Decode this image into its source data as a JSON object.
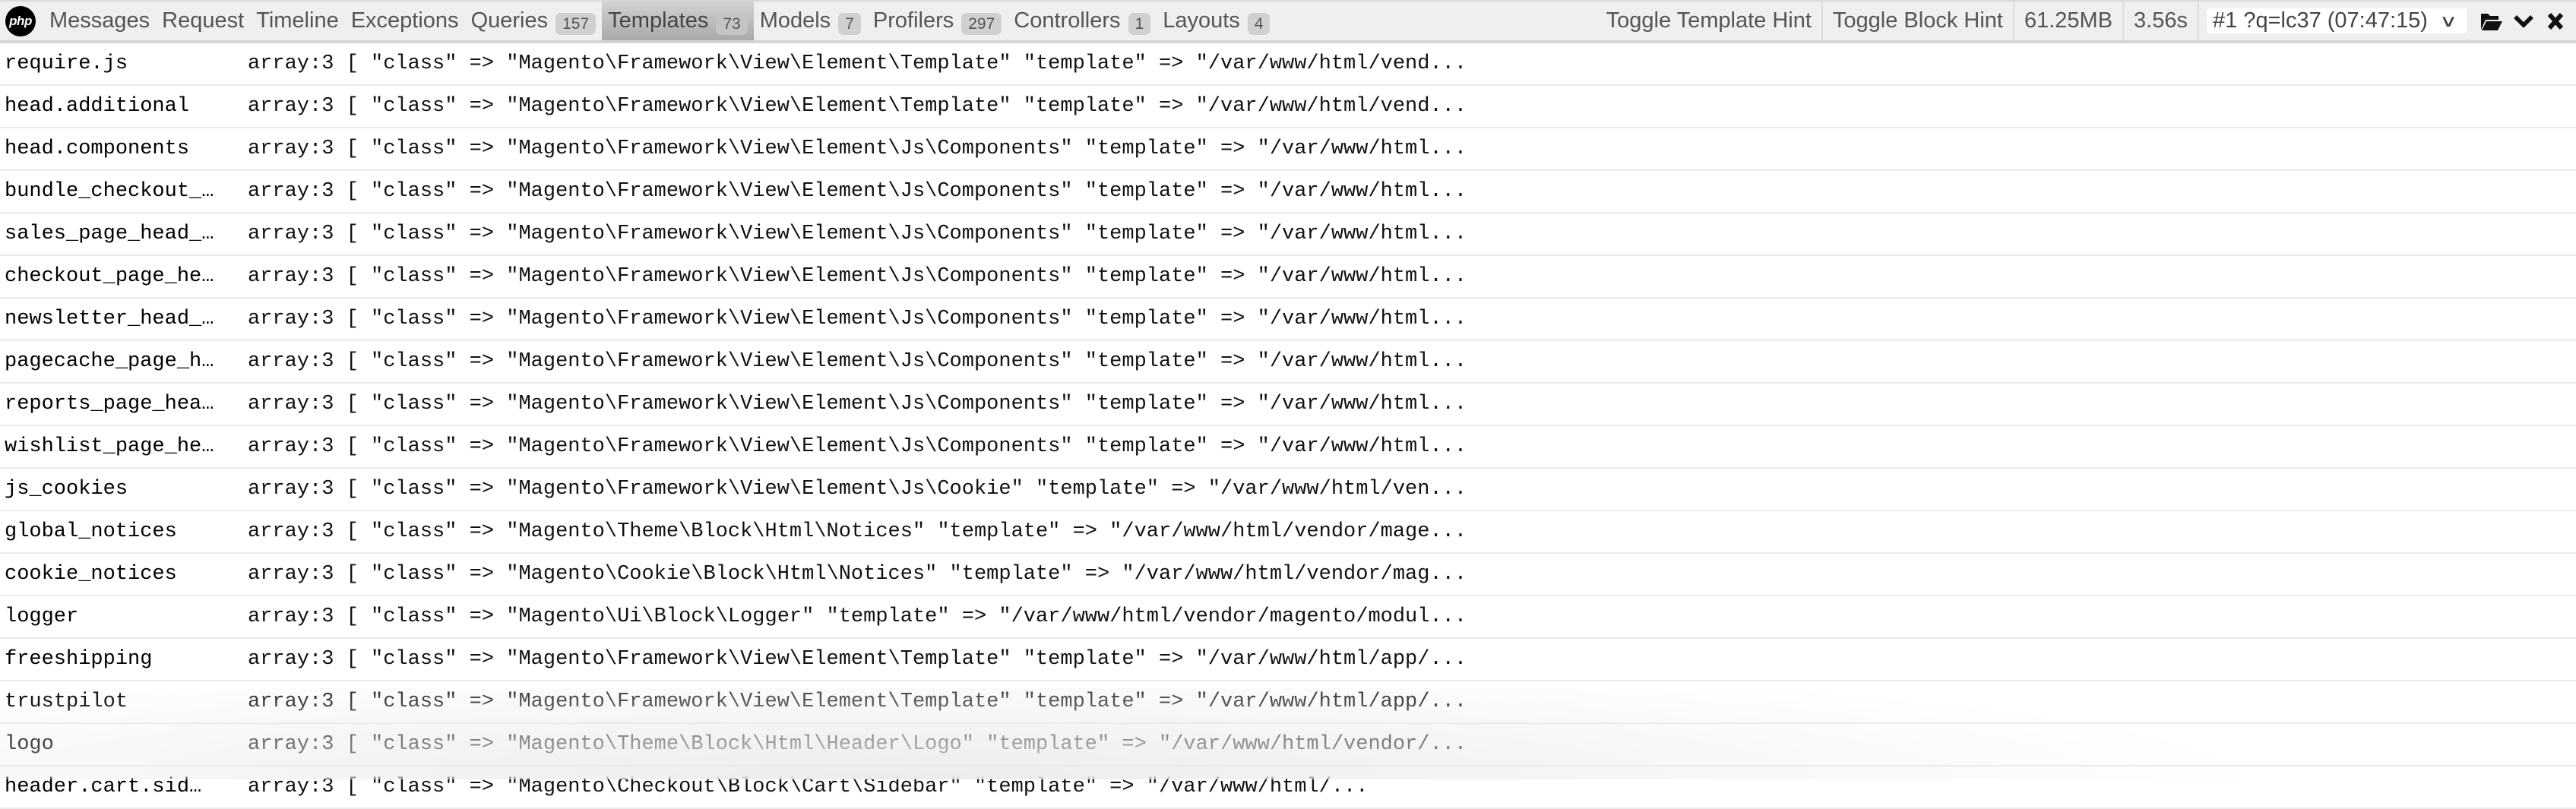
{
  "toolbar": {
    "logo_text": "php",
    "tabs": [
      {
        "label": "Messages",
        "badge": null
      },
      {
        "label": "Request",
        "badge": null
      },
      {
        "label": "Timeline",
        "badge": null
      },
      {
        "label": "Exceptions",
        "badge": null
      },
      {
        "label": "Queries",
        "badge": "157"
      },
      {
        "label": "Templates",
        "badge": "73",
        "active": true
      },
      {
        "label": "Models",
        "badge": "7"
      },
      {
        "label": "Profilers",
        "badge": "297"
      },
      {
        "label": "Controllers",
        "badge": "1"
      },
      {
        "label": "Layouts",
        "badge": "4"
      }
    ],
    "toggle_template_hint": "Toggle Template Hint",
    "toggle_block_hint": "Toggle Block Hint",
    "memory": "61.25MB",
    "duration": "3.56s",
    "request_select": "#1 ?q=lc37 (07:47:15)",
    "icons": {
      "open": "folder-open-icon",
      "minimize": "chevron-down-icon",
      "close": "close-icon"
    }
  },
  "templates": [
    {
      "name": "require.js",
      "value": "array:3 [ \"class\" => \"Magento\\Framework\\View\\Element\\Template\" \"template\" => \"/var/www/html/vend..."
    },
    {
      "name": "head.additional",
      "value": "array:3 [ \"class\" => \"Magento\\Framework\\View\\Element\\Template\" \"template\" => \"/var/www/html/vend..."
    },
    {
      "name": "head.components",
      "value": "array:3 [ \"class\" => \"Magento\\Framework\\View\\Element\\Js\\Components\" \"template\" => \"/var/www/html..."
    },
    {
      "name": "bundle_checkout_…",
      "value": "array:3 [ \"class\" => \"Magento\\Framework\\View\\Element\\Js\\Components\" \"template\" => \"/var/www/html..."
    },
    {
      "name": "sales_page_head_…",
      "value": "array:3 [ \"class\" => \"Magento\\Framework\\View\\Element\\Js\\Components\" \"template\" => \"/var/www/html..."
    },
    {
      "name": "checkout_page_he…",
      "value": "array:3 [ \"class\" => \"Magento\\Framework\\View\\Element\\Js\\Components\" \"template\" => \"/var/www/html..."
    },
    {
      "name": "newsletter_head_…",
      "value": "array:3 [ \"class\" => \"Magento\\Framework\\View\\Element\\Js\\Components\" \"template\" => \"/var/www/html..."
    },
    {
      "name": "pagecache_page_h…",
      "value": "array:3 [ \"class\" => \"Magento\\Framework\\View\\Element\\Js\\Components\" \"template\" => \"/var/www/html..."
    },
    {
      "name": "reports_page_hea…",
      "value": "array:3 [ \"class\" => \"Magento\\Framework\\View\\Element\\Js\\Components\" \"template\" => \"/var/www/html..."
    },
    {
      "name": "wishlist_page_he…",
      "value": "array:3 [ \"class\" => \"Magento\\Framework\\View\\Element\\Js\\Components\" \"template\" => \"/var/www/html..."
    },
    {
      "name": "js_cookies",
      "value": "array:3 [ \"class\" => \"Magento\\Framework\\View\\Element\\Js\\Cookie\" \"template\" => \"/var/www/html/ven..."
    },
    {
      "name": "global_notices",
      "value": "array:3 [ \"class\" => \"Magento\\Theme\\Block\\Html\\Notices\" \"template\" => \"/var/www/html/vendor/mage..."
    },
    {
      "name": "cookie_notices",
      "value": "array:3 [ \"class\" => \"Magento\\Cookie\\Block\\Html\\Notices\" \"template\" => \"/var/www/html/vendor/mag..."
    },
    {
      "name": "logger",
      "value": "array:3 [ \"class\" => \"Magento\\Ui\\Block\\Logger\" \"template\" => \"/var/www/html/vendor/magento/modul..."
    },
    {
      "name": "freeshipping",
      "value": "array:3 [ \"class\" => \"Magento\\Framework\\View\\Element\\Template\" \"template\" => \"/var/www/html/app/..."
    },
    {
      "name": "trustpilot",
      "value": "array:3 [ \"class\" => \"Magento\\Framework\\View\\Element\\Template\" \"template\" => \"/var/www/html/app/..."
    },
    {
      "name": "logo",
      "value": "array:3 [ \"class\" => \"Magento\\Theme\\Block\\Html\\Header\\Logo\" \"template\" => \"/var/www/html/vendor/..."
    },
    {
      "name": "header.cart.sid…",
      "value": "array:3 [ \"class\" => \"Magento\\Checkout\\Block\\Cart\\Sidebar\" \"template\" => \"/var/www/html/..."
    }
  ]
}
